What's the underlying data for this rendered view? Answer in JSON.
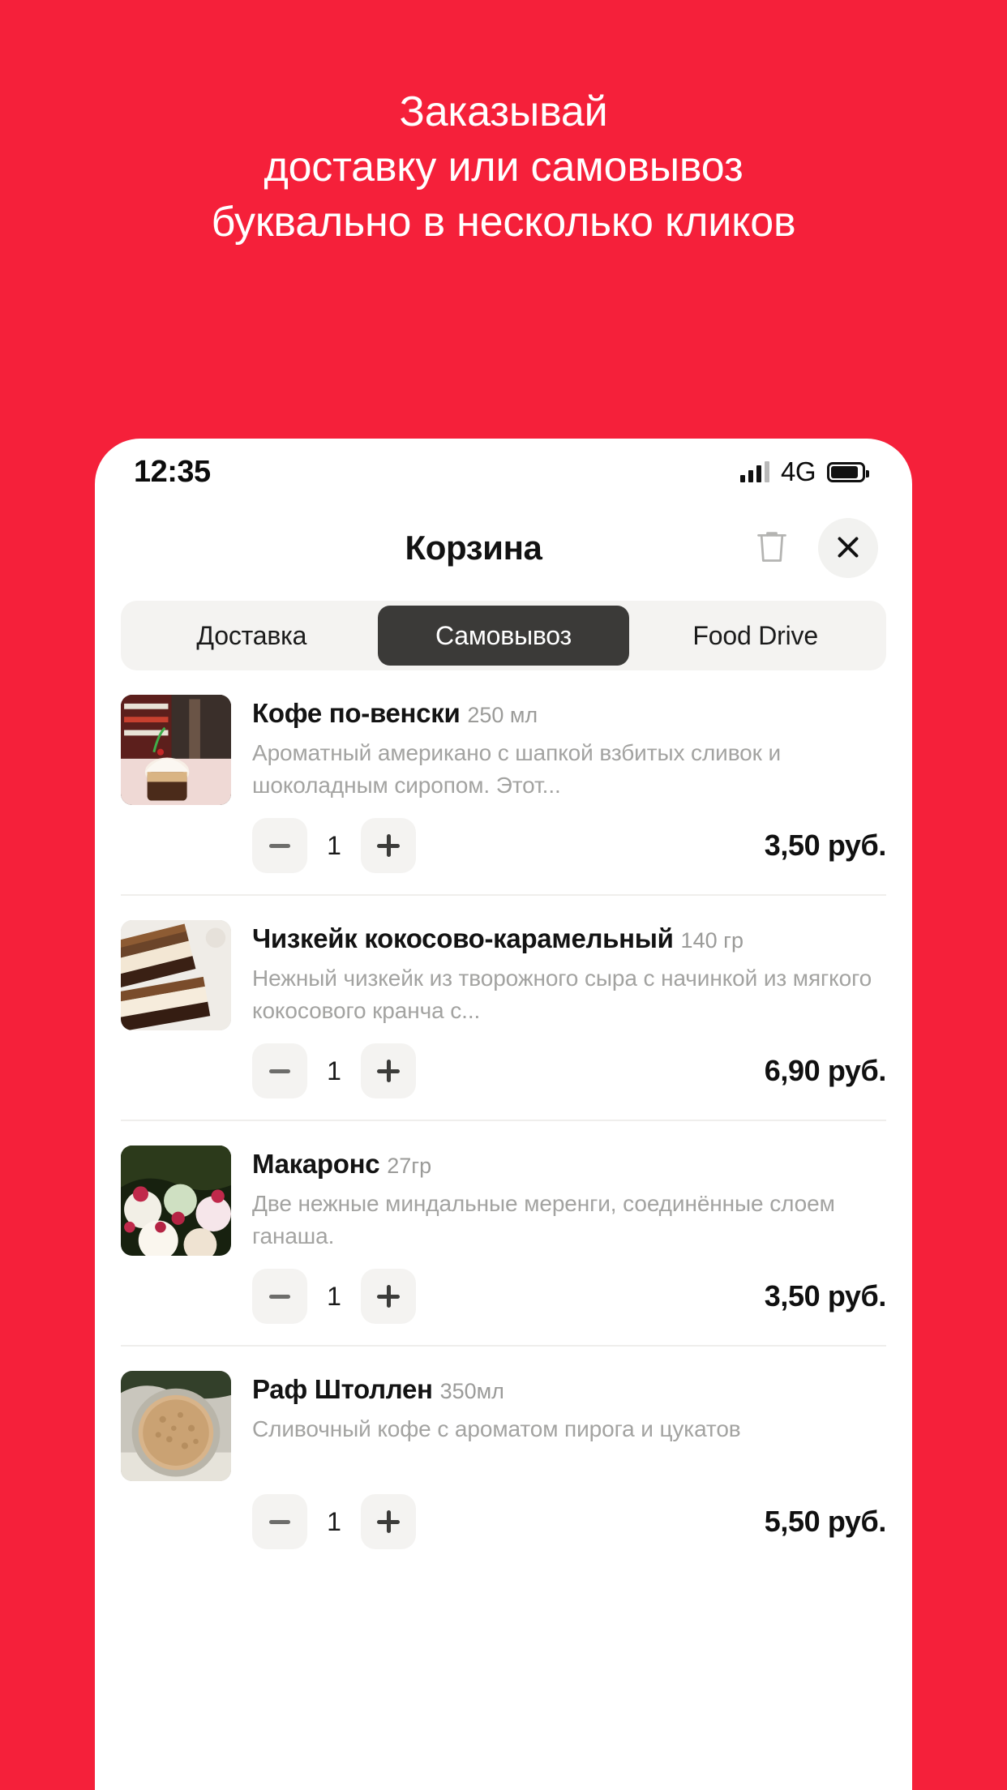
{
  "promo": {
    "lines": [
      "Заказывай",
      "доставку или самовывоз",
      "буквально в несколько кликов"
    ]
  },
  "colors": {
    "background": "#F5203A",
    "active_tab": "#3B3A38",
    "surface": "#FFFFFF",
    "muted_text": "#A3A3A1",
    "chip": "#F4F3F1"
  },
  "phone": {
    "status_bar": {
      "time": "12:35",
      "network": "4G",
      "signal_icon": "signal-bars-icon",
      "battery_icon": "battery-icon"
    },
    "header": {
      "title": "Корзина",
      "trash_icon": "trash-icon",
      "close_icon": "close-icon"
    },
    "tabs": [
      {
        "label": "Доставка",
        "active": false
      },
      {
        "label": "Самовывоз",
        "active": true
      },
      {
        "label": "Food Drive",
        "active": false
      }
    ],
    "cart_items": [
      {
        "name": "Кофе по-венски",
        "weight": "250 мл",
        "description": "Ароматный американо с шапкой взбитых сливок и шоколадным сиропом. Этот...",
        "quantity": "1",
        "price": "3,50 руб.",
        "decrement_label": "minus-icon",
        "increment_label": "plus-icon",
        "thumb": "coffee-vienna-photo"
      },
      {
        "name": "Чизкейк кокосово-карамельный",
        "weight": "140 гр",
        "description": "Нежный чизкейк из творожного сыра с начинкой из мягкого кокосового кранча с...",
        "quantity": "1",
        "price": "6,90 руб.",
        "decrement_label": "minus-icon",
        "increment_label": "plus-icon",
        "thumb": "cheesecake-photo"
      },
      {
        "name": "Макаронс",
        "weight": "27гр",
        "description": "Две нежные миндальные меренги, соединённые слоем ганаша.",
        "quantity": "1",
        "price": "3,50 руб.",
        "decrement_label": "minus-icon",
        "increment_label": "plus-icon",
        "thumb": "macarons-photo"
      },
      {
        "name": "Раф Штоллен",
        "weight": "350мл",
        "description": "Сливочный кофе с ароматом пирога и цукатов",
        "quantity": "1",
        "price": "5,50 руб.",
        "decrement_label": "minus-icon",
        "increment_label": "plus-icon",
        "thumb": "raf-stollen-photo"
      }
    ]
  }
}
